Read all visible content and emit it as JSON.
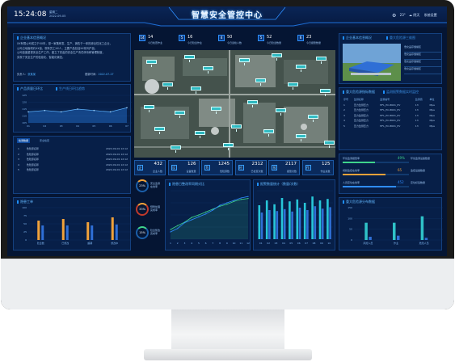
{
  "header": {
    "title": "智慧安全管控中心",
    "time": "15:24:08",
    "weekday": "星期二",
    "date": "2022-09-05",
    "temp": "23°",
    "weather": "阴天",
    "settings_label": "系统设置"
  },
  "left_top": {
    "title": "企业基本信息概况",
    "body": [
      "XX有限公司成立于XX年，是一家集研发、生产、销售于一体的综合性化工企业，",
      "公司占地面积约XX亩，现有员工XX人，主要产品包括XX系列产品。",
      "公司高度重视安全生产工作，建立了完善的安全生产责任体系和管理制度，",
      "实现了安全生产的信息化、智能化管控。"
    ],
    "contact_label": "负责人：",
    "contact_name": "张某某",
    "update_label": "更新时间：",
    "update": "2022-07-27"
  },
  "left_mid": {
    "title": "产品质量日环比",
    "subtitle": "生产线日环比趋势",
    "y_ticks": [
      "125",
      "120",
      "115",
      "110",
      "105"
    ],
    "x_ticks": [
      "01",
      "02",
      "03",
      "04",
      "05",
      "06",
      "07"
    ]
  },
  "left_table": {
    "tab_active": "检测数据",
    "tab_other": "安全检查",
    "rows": [
      [
        "1",
        "危险源名称",
        "2022-09-01 12:12"
      ],
      [
        "2",
        "危险源名称",
        "2022-09-01 12:12"
      ],
      [
        "3",
        "危险源名称",
        "2022-09-01 12:12"
      ],
      [
        "4",
        "危险源名称",
        "2022-09-01 12:12"
      ],
      [
        "5",
        "危险源名称",
        "2022-09-01 12:12"
      ]
    ]
  },
  "left_bottom": {
    "title": "隐患工单",
    "y_ticks": [
      "100",
      "75",
      "50",
      "25",
      "0"
    ],
    "categories": [
      "隐患数",
      "已整改",
      "超期",
      "整改中"
    ]
  },
  "kpis": [
    {
      "icon": "14",
      "value": "14",
      "label": "今日检查作业"
    },
    {
      "icon": "5",
      "value": "16",
      "label": "今日隐患作业"
    },
    {
      "icon": "4",
      "value": "50",
      "label": "今日巡检人数"
    },
    {
      "icon": "5",
      "value": "52",
      "label": "今日隐患数量"
    },
    {
      "icon": "6",
      "value": "23",
      "label": "今日报警数量"
    }
  ],
  "stats": [
    {
      "icon": "企",
      "value": "432",
      "label": "企业人数"
    },
    {
      "icon": "设",
      "value": "126",
      "label": "设备数量"
    },
    {
      "icon": "危",
      "value": "1245",
      "label": "危险源数"
    },
    {
      "icon": "检",
      "value": "2312",
      "label": "已检查次数"
    },
    {
      "icon": "报",
      "value": "2117",
      "label": "报警次数"
    },
    {
      "icon": "作",
      "value": "125",
      "label": "作业总数"
    }
  ],
  "rings": [
    {
      "pct": "23%",
      "label": "安全监测\n在线率"
    },
    {
      "pct": "33%",
      "label": "预警处理\n完成率"
    },
    {
      "pct": "15%",
      "label": "隐患整改\n完成率"
    }
  ],
  "line_panel": {
    "title": "隐患日整改率同期对比",
    "x_ticks": [
      "1",
      "2",
      "3",
      "4",
      "5",
      "6",
      "7",
      "8",
      "9",
      "10",
      "11",
      "12"
    ]
  },
  "bar_panel": {
    "title": "报警数量统计（数量/次数）",
    "x_ticks": [
      "01",
      "02",
      "03",
      "04",
      "05",
      "06",
      "07",
      "08",
      "09",
      "10"
    ]
  },
  "right_top": {
    "title": "企业基本信息概况",
    "link": "重大危险源三维图",
    "items": [
      "危化品存储罐区",
      "危化品存储罐区",
      "危化品存储罐区",
      "危化品存储罐区"
    ]
  },
  "right_table": {
    "title": "重大危险源指标数据",
    "link": "监测报警数据实时监控",
    "headers": [
      "序号",
      "监测名称",
      "监测编号",
      "监测值",
      "单位"
    ],
    "rows": [
      [
        "1",
        "压力监测压力",
        "HFL_PC-8601_PV",
        "13",
        "Mpa"
      ],
      [
        "2",
        "压力监测压力",
        "HFL_PC-8601_PV",
        "13",
        "Mpa"
      ],
      [
        "3",
        "压力监测压力",
        "HFL_PC-8601_PV",
        "13",
        "Mpa"
      ],
      [
        "4",
        "压力监测压力",
        "HFL_PC-8601_PV",
        "13",
        "Mpa"
      ],
      [
        "5",
        "压力监测压力",
        "HFL_PC-8601_PV",
        "13",
        "Mpa"
      ]
    ]
  },
  "right_gauges": [
    {
      "label": "环境监测报警率",
      "value": "49%",
      "extra": "环境监测设备数量",
      "pct": 49,
      "color": "#3fd38c"
    },
    {
      "label": "视频监控在线率",
      "value": "65",
      "extra": "监控设备数量",
      "pct": 65,
      "color": "#f1a23a"
    },
    {
      "label": "人员定位在线率",
      "value": "452",
      "extra": "定位标签数量",
      "pct": 80,
      "color": "#2f8cff"
    }
  ],
  "right_bottom": {
    "title": "重大危险源分布数据",
    "y_ticks": [
      "150",
      "100",
      "50",
      "0"
    ],
    "categories": [
      "风险人员",
      "作业",
      "危险人员"
    ]
  },
  "chart_data": [
    {
      "type": "area",
      "title": "产品质量日环比",
      "x": [
        "01",
        "02",
        "03",
        "04",
        "05",
        "06",
        "07"
      ],
      "values": [
        113,
        114,
        113,
        115,
        114,
        113,
        116
      ],
      "ylim": [
        105,
        125
      ]
    },
    {
      "type": "bar",
      "title": "隐患工单",
      "categories": [
        "隐患数",
        "已整改",
        "超期",
        "整改中"
      ],
      "series": [
        {
          "values": [
            60,
            65,
            55,
            70
          ]
        },
        {
          "values": [
            45,
            45,
            45,
            48
          ]
        }
      ],
      "ylim": [
        0,
        100
      ]
    },
    {
      "type": "line",
      "title": "隐患日整改率同期对比",
      "x": [
        "1",
        "2",
        "3",
        "4",
        "5",
        "6",
        "7",
        "8",
        "9",
        "10",
        "11",
        "12"
      ],
      "series": [
        {
          "values": [
            20,
            28,
            35,
            45,
            50,
            56,
            62,
            68,
            72,
            78,
            82,
            84
          ],
          "color": "#3fd38c"
        },
        {
          "values": [
            15,
            22,
            34,
            40,
            46,
            52,
            60,
            70,
            75,
            80,
            85,
            88
          ],
          "color": "#2f8cff"
        }
      ],
      "ylim": [
        0,
        100
      ]
    },
    {
      "type": "bar",
      "title": "报警数量统计（数量/次数）",
      "categories": [
        "01",
        "02",
        "03",
        "04",
        "05",
        "06",
        "07",
        "08",
        "09",
        "10"
      ],
      "series": [
        {
          "values": [
            70,
            80,
            72,
            85,
            78,
            82,
            75,
            88,
            80,
            83
          ],
          "color": "#27c6d8"
        },
        {
          "values": [
            55,
            60,
            58,
            62,
            57,
            65,
            60,
            68,
            63,
            66
          ],
          "color": "#2f6fd6"
        }
      ],
      "ylim": [
        0,
        100
      ]
    },
    {
      "type": "bar",
      "title": "重大危险源分布数据",
      "categories": [
        "风险人员",
        "作业",
        "危险人员"
      ],
      "series": [
        {
          "values": [
            80,
            80,
            110
          ],
          "color": "#2fc2c8"
        },
        {
          "values": [
            15,
            20,
            10
          ],
          "color": "#2f6fd6"
        }
      ],
      "ylim": [
        0,
        150
      ]
    }
  ]
}
